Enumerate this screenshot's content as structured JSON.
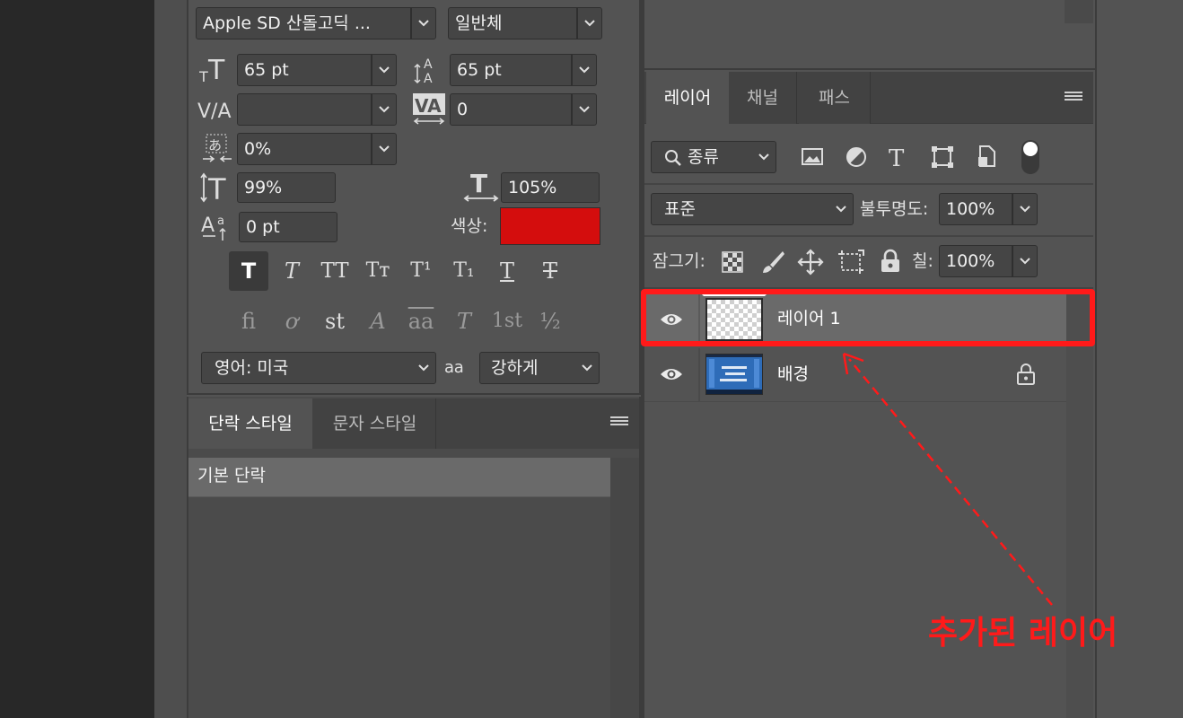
{
  "character": {
    "font_family": "Apple SD 산돌고딕 ...",
    "font_style": "일반체",
    "font_size": "65 pt",
    "leading": "65 pt",
    "kerning": "",
    "tracking": "0",
    "tsume": "0%",
    "vertical_scale": "99%",
    "horizontal_scale": "105%",
    "baseline_shift": "0 pt",
    "color_label": "색상:",
    "color_value": "#d40d0d",
    "language": "영어: 미국",
    "antialias": "강하게",
    "antialias_icon": "a a",
    "style_buttons": [
      "T",
      "T",
      "TT",
      "Tт",
      "T¹",
      "T₁",
      "T",
      "T"
    ],
    "opentype_buttons": [
      "ﬁ",
      "ơ",
      "st",
      "A",
      "aa",
      "T",
      "1st",
      "½"
    ]
  },
  "paragraph_styles": {
    "tabs": [
      "단락 스타일",
      "문자 스타일"
    ],
    "items": [
      "기본 단락"
    ]
  },
  "layers": {
    "tabs": [
      "레이어",
      "채널",
      "패스"
    ],
    "filter_label": "종류",
    "blend_mode": "표준",
    "opacity_label": "불투명도:",
    "opacity_value": "100%",
    "lock_label": "잠그기:",
    "fill_label": "칠:",
    "fill_value": "100%",
    "rows": [
      {
        "name": "레이어 1",
        "selected": true,
        "locked": false,
        "thumbnail": "transparent"
      },
      {
        "name": "배경",
        "selected": false,
        "locked": true,
        "thumbnail": "photo"
      }
    ]
  },
  "annotation": {
    "text": "추가된 레이어",
    "color": "#ff1a1a"
  }
}
